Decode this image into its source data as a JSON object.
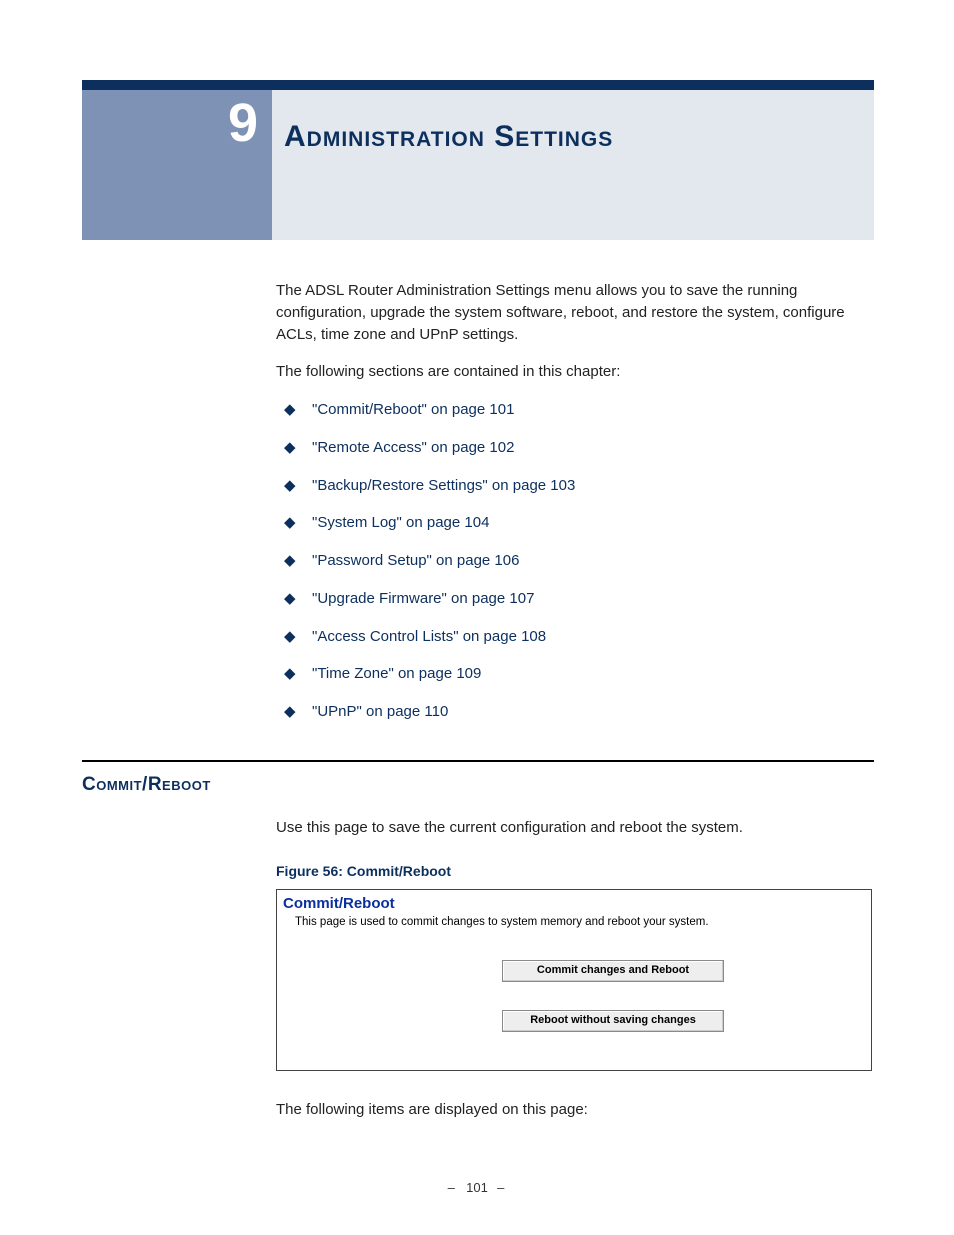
{
  "chapter": {
    "number": "9",
    "title": "Administration Settings"
  },
  "intro": {
    "p1": "The ADSL Router Administration Settings menu allows you to save the running configuration, upgrade the system software, reboot, and restore the system, configure ACLs, time zone and UPnP settings.",
    "p2": "The following sections are contained in this chapter:"
  },
  "toc": [
    "\"Commit/Reboot\" on page 101",
    "\"Remote Access\" on page 102",
    "\"Backup/Restore Settings\" on page 103",
    "\"System Log\" on page 104",
    "\"Password Setup\" on page 106",
    "\"Upgrade Firmware\" on page 107",
    "\"Access Control Lists\" on page 108",
    "\"Time Zone\" on page 109",
    "\"UPnP\" on page 110"
  ],
  "section": {
    "heading": "Commit/Reboot",
    "p1": "Use this page to save the current configuration and reboot the system.",
    "figure_caption": "Figure 56:  Commit/Reboot",
    "figure": {
      "title": "Commit/Reboot",
      "subtitle": "This page is used to commit changes to system memory and reboot your system.",
      "button1": "Commit changes and Reboot",
      "button2": "Reboot without saving changes"
    },
    "p2": "The following items are displayed on this page:"
  },
  "footer": {
    "page": "101"
  }
}
